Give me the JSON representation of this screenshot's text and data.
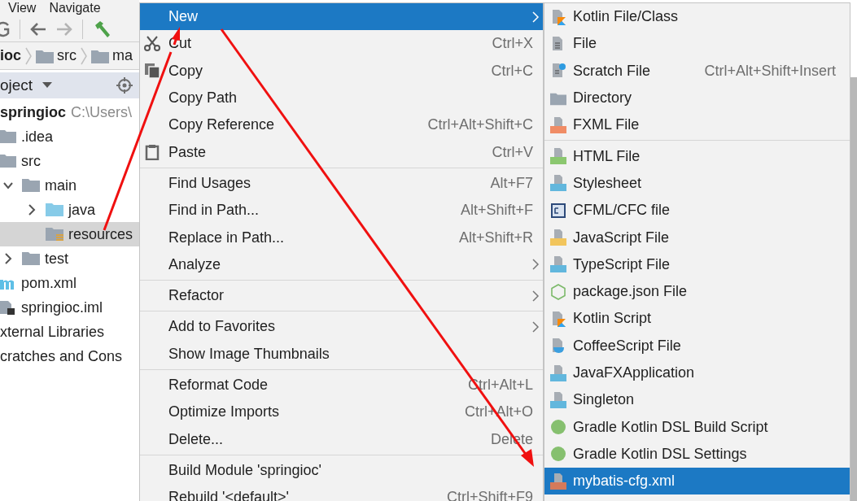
{
  "menubar": [
    {
      "label": "View"
    },
    {
      "label": "Navigate"
    }
  ],
  "breadcrumb": [
    "ioc",
    "src",
    "ma"
  ],
  "project_panel": {
    "title": "oject"
  },
  "tree": [
    {
      "label": "springioc",
      "hint": "C:\\Users\\",
      "kind": "module",
      "selected": false,
      "children": [
        {
          "label": ".idea",
          "kind": "folder",
          "selected": false
        },
        {
          "label": "src",
          "kind": "folder",
          "selected": false,
          "children": [
            {
              "label": "main",
              "kind": "folder",
              "selected": false,
              "expanded": true,
              "children": [
                {
                  "label": "java",
                  "kind": "source",
                  "selected": false,
                  "expanded": false
                },
                {
                  "label": "resources",
                  "kind": "resources",
                  "selected": true
                }
              ]
            },
            {
              "label": "test",
              "kind": "folder",
              "selected": false,
              "expanded": false
            }
          ]
        },
        {
          "label": "pom.xml",
          "kind": "maven",
          "selected": false
        },
        {
          "label": "springioc.iml",
          "kind": "iml",
          "selected": false
        }
      ]
    },
    {
      "label": "xternal Libraries",
      "kind": "plain",
      "selected": false
    },
    {
      "label": "cratches and Cons",
      "kind": "plain",
      "selected": false
    }
  ],
  "context_menu": {
    "items": [
      {
        "kind": "item",
        "label": "New",
        "selected": true,
        "submenu": true
      },
      {
        "kind": "cut",
        "label": "Cut",
        "shortcut": "Ctrl+X",
        "selected": false,
        "submenu": false
      },
      {
        "kind": "copy",
        "label": "Copy",
        "shortcut": "Ctrl+C",
        "selected": false,
        "submenu": false
      },
      {
        "kind": "item",
        "label": "Copy Path",
        "selected": false,
        "submenu": false
      },
      {
        "kind": "item",
        "label": "Copy Reference",
        "shortcut": "Ctrl+Alt+Shift+C",
        "selected": false,
        "submenu": false
      },
      {
        "kind": "paste",
        "label": "Paste",
        "shortcut": "Ctrl+V",
        "selected": false,
        "submenu": false
      },
      {
        "kind": "separator"
      },
      {
        "kind": "item",
        "label": "Find Usages",
        "shortcut": "Alt+F7",
        "selected": false,
        "submenu": false
      },
      {
        "kind": "item",
        "label": "Find in Path...",
        "shortcut": "Alt+Shift+F",
        "selected": false,
        "submenu": false
      },
      {
        "kind": "item",
        "label": "Replace in Path...",
        "shortcut": "Alt+Shift+R",
        "selected": false,
        "submenu": false
      },
      {
        "kind": "item",
        "label": "Analyze",
        "selected": false,
        "submenu": true
      },
      {
        "kind": "separator"
      },
      {
        "kind": "item",
        "label": "Refactor",
        "selected": false,
        "submenu": true
      },
      {
        "kind": "separator"
      },
      {
        "kind": "item",
        "label": "Add to Favorites",
        "selected": false,
        "submenu": true
      },
      {
        "kind": "item",
        "label": "Show Image Thumbnails",
        "selected": false,
        "submenu": false
      },
      {
        "kind": "separator"
      },
      {
        "kind": "item",
        "label": "Reformat Code",
        "shortcut": "Ctrl+Alt+L",
        "selected": false,
        "submenu": false
      },
      {
        "kind": "item",
        "label": "Optimize Imports",
        "shortcut": "Ctrl+Alt+O",
        "selected": false,
        "submenu": false
      },
      {
        "kind": "item",
        "label": "Delete...",
        "shortcut": "Delete",
        "selected": false,
        "submenu": false
      },
      {
        "kind": "separator"
      },
      {
        "kind": "item",
        "label": "Build Module 'springioc'",
        "selected": false,
        "submenu": false
      },
      {
        "kind": "item",
        "label": "Rebuild '<default>'",
        "shortcut": "Ctrl+Shift+F9",
        "selected": false,
        "submenu": false
      }
    ]
  },
  "new_submenu": {
    "items": [
      {
        "kind": "kotlin",
        "label": "Kotlin File/Class",
        "selected": false
      },
      {
        "kind": "file",
        "label": "File",
        "selected": false
      },
      {
        "kind": "scratch",
        "label": "Scratch File",
        "shortcut": "Ctrl+Alt+Shift+Insert",
        "selected": false
      },
      {
        "kind": "folder",
        "label": "Directory",
        "selected": false
      },
      {
        "kind": "badge",
        "label": "FXML File",
        "color": "#f08c65",
        "selected": false
      },
      {
        "kind": "separator"
      },
      {
        "kind": "badge",
        "label": "HTML File",
        "color": "#8bc76f",
        "selected": false
      },
      {
        "kind": "badge",
        "label": "Stylesheet",
        "color": "#62b7dd",
        "selected": false
      },
      {
        "kind": "cfml",
        "label": "CFML/CFC file",
        "selected": false
      },
      {
        "kind": "badge",
        "label": "JavaScript File",
        "color": "#f2c55c",
        "selected": false
      },
      {
        "kind": "badge",
        "label": "TypeScript File",
        "color": "#62b7dd",
        "selected": false
      },
      {
        "kind": "nodejs",
        "label": "package.json File",
        "selected": false
      },
      {
        "kind": "kotlin",
        "label": "Kotlin Script",
        "selected": false
      },
      {
        "kind": "coffee",
        "label": "CoffeeScript File",
        "selected": false
      },
      {
        "kind": "badge",
        "label": "JavaFXApplication",
        "color": "#62b7dd",
        "selected": false
      },
      {
        "kind": "badge",
        "label": "Singleton",
        "color": "#62b7dd",
        "selected": false
      },
      {
        "kind": "gradle",
        "label": "Gradle Kotlin DSL Build Script",
        "selected": false
      },
      {
        "kind": "gradle",
        "label": "Gradle Kotlin DSL Settings",
        "selected": false
      },
      {
        "kind": "badge",
        "label": "mybatis-cfg.xml",
        "color": "#d67a5a",
        "selected": true
      }
    ]
  }
}
